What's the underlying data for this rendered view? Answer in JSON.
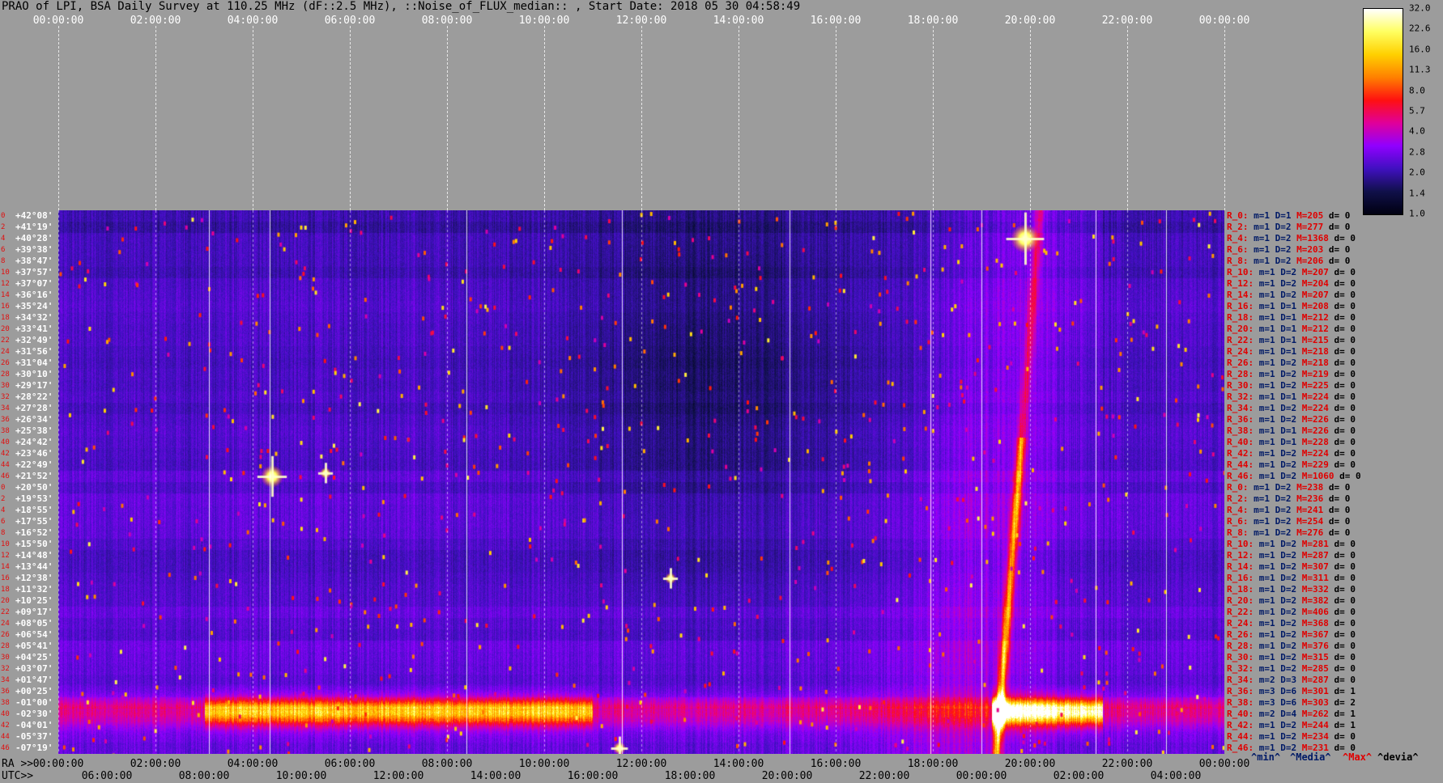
{
  "title": "PRAO of LPI, BSA Daily Survey at 110.25 MHz (dF::2.5 MHz), ::Noise_of_FLUX_median:: , Start Date: 2018 05 30 04:58:49",
  "top_axis": [
    "00:00:00",
    "02:00:00",
    "04:00:00",
    "06:00:00",
    "08:00:00",
    "10:00:00",
    "12:00:00",
    "14:00:00",
    "16:00:00",
    "18:00:00",
    "20:00:00",
    "22:00:00",
    "00:00:00"
  ],
  "ra_axis": {
    "label": "RA >>",
    "ticks": [
      "00:00:00",
      "02:00:00",
      "04:00:00",
      "06:00:00",
      "08:00:00",
      "10:00:00",
      "12:00:00",
      "14:00:00",
      "16:00:00",
      "18:00:00",
      "20:00:00",
      "22:00:00",
      "00:00:00"
    ]
  },
  "utc_axis": {
    "label": "UTC>>",
    "ticks": [
      "06:00:00",
      "08:00:00",
      "10:00:00",
      "12:00:00",
      "14:00:00",
      "16:00:00",
      "18:00:00",
      "20:00:00",
      "22:00:00",
      "00:00:00",
      "02:00:00",
      "04:00:00"
    ]
  },
  "declinations": [
    "+42°08'",
    "+41°19'",
    "+40°28'",
    "+39°38'",
    "+38°47'",
    "+37°57'",
    "+37°07'",
    "+36°16'",
    "+35°24'",
    "+34°32'",
    "+33°41'",
    "+32°49'",
    "+31°56'",
    "+31°04'",
    "+30°10'",
    "+29°17'",
    "+28°22'",
    "+27°28'",
    "+26°34'",
    "+25°38'",
    "+24°42'",
    "+23°46'",
    "+22°49'",
    "+21°52'",
    "+20°50'",
    "+19°53'",
    "+18°55'",
    "+17°55'",
    "+16°52'",
    "+15°50'",
    "+14°48'",
    "+13°44'",
    "+12°38'",
    "+11°32'",
    "+10°25'",
    "+09°17'",
    "+08°05'",
    "+06°54'",
    "+05°41'",
    "+04°25'",
    "+03°07'",
    "+01°47'",
    "+00°25'",
    "-01°00'",
    "-02°30'",
    "-04°01'",
    "-05°37'",
    "-07°19'"
  ],
  "row_index": [
    "0",
    "2",
    "4",
    "6",
    "8",
    "10",
    "12",
    "14",
    "16",
    "18",
    "20",
    "22",
    "24",
    "26",
    "28",
    "30",
    "32",
    "34",
    "36",
    "38",
    "40",
    "42",
    "44",
    "46",
    "0",
    "2",
    "4",
    "6",
    "8",
    "10",
    "12",
    "14",
    "16",
    "18",
    "20",
    "22",
    "24",
    "26",
    "28",
    "30",
    "32",
    "34",
    "36",
    "38",
    "40",
    "42",
    "44",
    "46"
  ],
  "stats": [
    {
      "r": "R_0:",
      "m": "m=1",
      "d": "D=1",
      "mx": "M=205",
      "dv": "d= 0"
    },
    {
      "r": "R_2:",
      "m": "m=1",
      "d": "D=2",
      "mx": "M=277",
      "dv": "d= 0"
    },
    {
      "r": "R_4:",
      "m": "m=1",
      "d": "D=2",
      "mx": "M=1368",
      "dv": "d= 0"
    },
    {
      "r": "R_6:",
      "m": "m=1",
      "d": "D=2",
      "mx": "M=203",
      "dv": "d= 0"
    },
    {
      "r": "R_8:",
      "m": "m=1",
      "d": "D=2",
      "mx": "M=206",
      "dv": "d= 0"
    },
    {
      "r": "R_10:",
      "m": "m=1",
      "d": "D=2",
      "mx": "M=207",
      "dv": "d= 0"
    },
    {
      "r": "R_12:",
      "m": "m=1",
      "d": "D=2",
      "mx": "M=204",
      "dv": "d= 0"
    },
    {
      "r": "R_14:",
      "m": "m=1",
      "d": "D=2",
      "mx": "M=207",
      "dv": "d= 0"
    },
    {
      "r": "R_16:",
      "m": "m=1",
      "d": "D=1",
      "mx": "M=208",
      "dv": "d= 0"
    },
    {
      "r": "R_18:",
      "m": "m=1",
      "d": "D=1",
      "mx": "M=212",
      "dv": "d= 0"
    },
    {
      "r": "R_20:",
      "m": "m=1",
      "d": "D=1",
      "mx": "M=212",
      "dv": "d= 0"
    },
    {
      "r": "R_22:",
      "m": "m=1",
      "d": "D=1",
      "mx": "M=215",
      "dv": "d= 0"
    },
    {
      "r": "R_24:",
      "m": "m=1",
      "d": "D=1",
      "mx": "M=218",
      "dv": "d= 0"
    },
    {
      "r": "R_26:",
      "m": "m=1",
      "d": "D=2",
      "mx": "M=218",
      "dv": "d= 0"
    },
    {
      "r": "R_28:",
      "m": "m=1",
      "d": "D=2",
      "mx": "M=219",
      "dv": "d= 0"
    },
    {
      "r": "R_30:",
      "m": "m=1",
      "d": "D=2",
      "mx": "M=225",
      "dv": "d= 0"
    },
    {
      "r": "R_32:",
      "m": "m=1",
      "d": "D=1",
      "mx": "M=224",
      "dv": "d= 0"
    },
    {
      "r": "R_34:",
      "m": "m=1",
      "d": "D=2",
      "mx": "M=224",
      "dv": "d= 0"
    },
    {
      "r": "R_36:",
      "m": "m=1",
      "d": "D=2",
      "mx": "M=226",
      "dv": "d= 0"
    },
    {
      "r": "R_38:",
      "m": "m=1",
      "d": "D=1",
      "mx": "M=226",
      "dv": "d= 0"
    },
    {
      "r": "R_40:",
      "m": "m=1",
      "d": "D=1",
      "mx": "M=228",
      "dv": "d= 0"
    },
    {
      "r": "R_42:",
      "m": "m=1",
      "d": "D=2",
      "mx": "M=224",
      "dv": "d= 0"
    },
    {
      "r": "R_44:",
      "m": "m=1",
      "d": "D=2",
      "mx": "M=229",
      "dv": "d= 0"
    },
    {
      "r": "R_46:",
      "m": "m=1",
      "d": "D=2",
      "mx": "M=1060",
      "dv": "d= 0"
    },
    {
      "r": "R_0:",
      "m": "m=1",
      "d": "D=2",
      "mx": "M=238",
      "dv": "d= 0"
    },
    {
      "r": "R_2:",
      "m": "m=1",
      "d": "D=2",
      "mx": "M=236",
      "dv": "d= 0"
    },
    {
      "r": "R_4:",
      "m": "m=1",
      "d": "D=2",
      "mx": "M=241",
      "dv": "d= 0"
    },
    {
      "r": "R_6:",
      "m": "m=1",
      "d": "D=2",
      "mx": "M=254",
      "dv": "d= 0"
    },
    {
      "r": "R_8:",
      "m": "m=1",
      "d": "D=2",
      "mx": "M=276",
      "dv": "d= 0"
    },
    {
      "r": "R_10:",
      "m": "m=1",
      "d": "D=2",
      "mx": "M=281",
      "dv": "d= 0"
    },
    {
      "r": "R_12:",
      "m": "m=1",
      "d": "D=2",
      "mx": "M=287",
      "dv": "d= 0"
    },
    {
      "r": "R_14:",
      "m": "m=1",
      "d": "D=2",
      "mx": "M=307",
      "dv": "d= 0"
    },
    {
      "r": "R_16:",
      "m": "m=1",
      "d": "D=2",
      "mx": "M=311",
      "dv": "d= 0"
    },
    {
      "r": "R_18:",
      "m": "m=1",
      "d": "D=2",
      "mx": "M=332",
      "dv": "d= 0"
    },
    {
      "r": "R_20:",
      "m": "m=1",
      "d": "D=2",
      "mx": "M=382",
      "dv": "d= 0"
    },
    {
      "r": "R_22:",
      "m": "m=1",
      "d": "D=2",
      "mx": "M=406",
      "dv": "d= 0"
    },
    {
      "r": "R_24:",
      "m": "m=1",
      "d": "D=2",
      "mx": "M=368",
      "dv": "d= 0"
    },
    {
      "r": "R_26:",
      "m": "m=1",
      "d": "D=2",
      "mx": "M=367",
      "dv": "d= 0"
    },
    {
      "r": "R_28:",
      "m": "m=1",
      "d": "D=2",
      "mx": "M=376",
      "dv": "d= 0"
    },
    {
      "r": "R_30:",
      "m": "m=1",
      "d": "D=2",
      "mx": "M=315",
      "dv": "d= 0"
    },
    {
      "r": "R_32:",
      "m": "m=1",
      "d": "D=2",
      "mx": "M=285",
      "dv": "d= 0"
    },
    {
      "r": "R_34:",
      "m": "m=2",
      "d": "D=3",
      "mx": "M=287",
      "dv": "d= 0"
    },
    {
      "r": "R_36:",
      "m": "m=3",
      "d": "D=6",
      "mx": "M=301",
      "dv": "d= 1"
    },
    {
      "r": "R_38:",
      "m": "m=3",
      "d": "D=6",
      "mx": "M=303",
      "dv": "d= 2"
    },
    {
      "r": "R_40:",
      "m": "m=2",
      "d": "D=4",
      "mx": "M=262",
      "dv": "d= 1"
    },
    {
      "r": "R_42:",
      "m": "m=1",
      "d": "D=2",
      "mx": "M=244",
      "dv": "d= 1"
    },
    {
      "r": "R_44:",
      "m": "m=1",
      "d": "D=2",
      "mx": "M=234",
      "dv": "d= 0"
    },
    {
      "r": "R_46:",
      "m": "m=1",
      "d": "D=2",
      "mx": "M=231",
      "dv": "d= 0"
    }
  ],
  "legend_footer": {
    "min": "^min^",
    "median": "^Media^",
    "max": "^Max^",
    "devia": "^devia^"
  },
  "colorbar": {
    "labels": [
      "32.0",
      "22.6",
      "16.0",
      "11.3",
      "8.0",
      "5.7",
      "4.0",
      "2.8",
      "2.0",
      "1.4",
      "1.0"
    ],
    "stops": [
      "#ffffff",
      "#ffff60",
      "#ffd000",
      "#ff8000",
      "#ff1010",
      "#e0009a",
      "#9000ff",
      "#4010c0",
      "#10104a",
      "#000010"
    ]
  },
  "chart_data": {
    "type": "heatmap",
    "title": "PRAO of LPI, BSA Daily Survey at 110.25 MHz (dF::2.5 MHz), ::Noise_of_FLUX_median:: , Start Date: 2018 05 30 04:58:49",
    "x_axis": "RA 00:00:00 - 24:00:00",
    "y_axis": "Declination +42°08' .. -07°19' (48 rows)",
    "color_scale": "log, 1.0 - 32.0",
    "features": [
      {
        "name": "bright horizontal band",
        "rows": "+00°25' .. -02°30'",
        "ra": "03:00 - 12:00 and 19:00 - 21:30",
        "level": "16-32"
      },
      {
        "name": "diagonal bright streak",
        "ra": "18:00 - 20:00",
        "rows": "-05°37' .. +42°08'",
        "level": "8-16"
      },
      {
        "name": "point source",
        "ra": "04:25",
        "dec": "+21°52'",
        "level": "32"
      },
      {
        "name": "point source",
        "ra": "19:55",
        "dec": "+40°28'",
        "level": "32"
      },
      {
        "name": "point source",
        "ra": "05:30",
        "dec": "+21°52'",
        "level": "22"
      },
      {
        "name": "point source",
        "ra": "12:45",
        "dec": "+12°38'",
        "level": "22"
      },
      {
        "name": "point source",
        "ra": "11:55",
        "dec": "-07°19'",
        "level": "32"
      }
    ]
  }
}
